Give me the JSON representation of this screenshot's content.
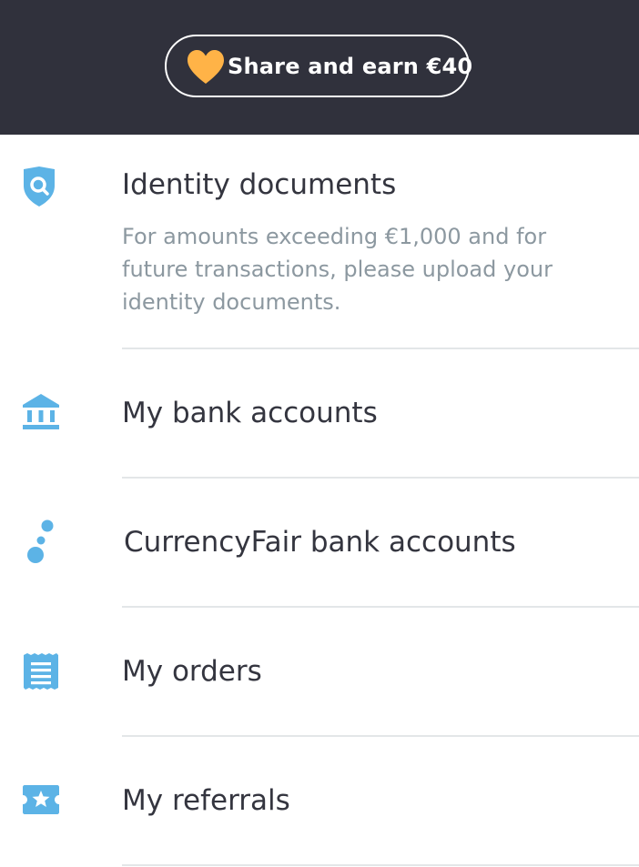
{
  "header": {
    "share_label": "Share and earn €40",
    "heart_icon": "heart-icon",
    "heart_color": "#ffb347",
    "background": "#30313c"
  },
  "menu": {
    "accent_color": "#5cb3e6",
    "items": [
      {
        "title": "Identity documents",
        "description": "For amounts exceeding €1,000 and for future transactions, please upload your identity documents.",
        "icon": "shield-search-icon"
      },
      {
        "title": "My bank accounts",
        "icon": "bank-icon"
      },
      {
        "title": "CurrencyFair bank accounts",
        "icon": "currencyfair-dots-icon"
      },
      {
        "title": "My orders",
        "icon": "receipt-icon"
      },
      {
        "title": "My referrals",
        "icon": "ticket-star-icon"
      }
    ]
  }
}
